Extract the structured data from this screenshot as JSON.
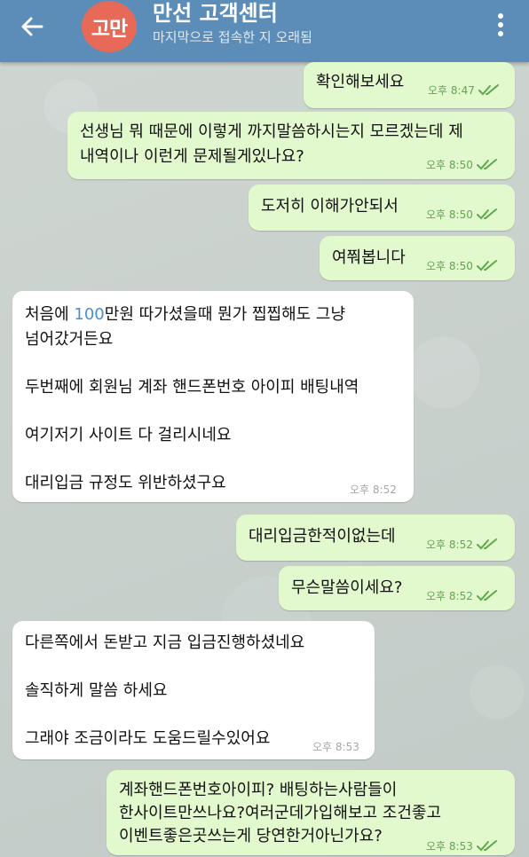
{
  "header": {
    "back_icon": "arrow-left-icon",
    "avatar_text": "고만",
    "avatar_color": "#e76a59",
    "title": "만선 고객센터",
    "subtitle": "마지막으로 접속한 지 오래됨",
    "menu_icon": "more-vertical-icon",
    "bar_color": "#5b8db8"
  },
  "messages": [
    {
      "dir": "out",
      "lines": [
        "확인해보세요"
      ],
      "time": "오후 8:47",
      "status": "read"
    },
    {
      "dir": "out",
      "lines": [
        "선생님 뭐 때문에 이렇게 까지말씀하시는지 모르겠는데 제",
        "내역이나 이런게 문제될게있나요?"
      ],
      "time": "오후 8:50",
      "status": "read"
    },
    {
      "dir": "out",
      "lines": [
        "도저히 이해가안되서"
      ],
      "time": "오후 8:50",
      "status": "read"
    },
    {
      "dir": "out",
      "lines": [
        "여쭤봅니다"
      ],
      "time": "오후 8:50",
      "status": "read"
    },
    {
      "dir": "in",
      "lines": [
        "처음에 100만원 따가셨을때 뭔가 찝찝해도 그냥",
        "넘어갔거든요",
        "",
        "두번째에 회원님 계좌 핸드폰번호 아이피 배팅내역",
        "",
        "여기저기 사이트 다 걸리시네요",
        "",
        "대리입금 규정도 위반하셨구요"
      ],
      "link_number": "100",
      "time": "오후 8:52"
    },
    {
      "dir": "out",
      "lines": [
        "대리입금한적이없는데"
      ],
      "time": "오후 8:52",
      "status": "read"
    },
    {
      "dir": "out",
      "lines": [
        "무슨말씀이세요?"
      ],
      "time": "오후 8:52",
      "status": "read"
    },
    {
      "dir": "in",
      "lines": [
        "다른쪽에서 돈받고 지금 입금진행하셨네요",
        "",
        "솔직하게 말씀 하세요",
        "",
        "그래야 조금이라도 도움드릴수있어요"
      ],
      "time": "오후 8:53"
    },
    {
      "dir": "out",
      "lines": [
        "계좌핸드폰번호아이피? 배팅하는사람들이",
        "한사이트만쓰나요?여러군데가입해보고 조건좋고",
        "이벤트좋은곳쓰는게 당연한거아닌가요?"
      ],
      "time": "오후 8:53",
      "status": "read"
    }
  ],
  "colors": {
    "outgoing": "#e2f8cd",
    "incoming": "#ffffff",
    "time_out": "#5ea84d",
    "time_in": "#a0a8ae",
    "link": "#4a8fd0"
  }
}
